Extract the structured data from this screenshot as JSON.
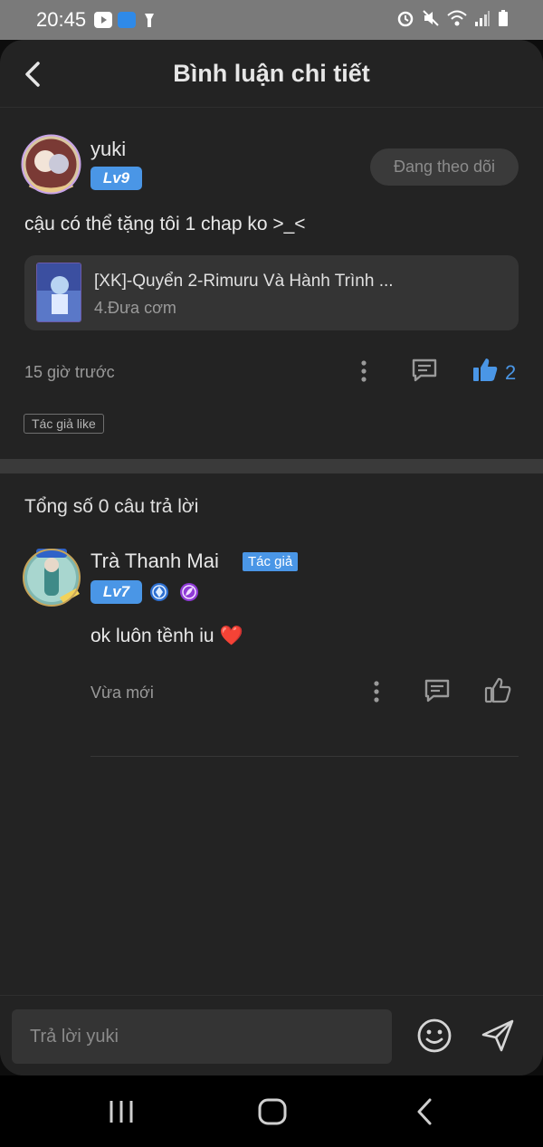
{
  "status_bar": {
    "time": "20:45",
    "icons": [
      "youtube-icon",
      "novel-app-icon",
      "flashlight-icon",
      "alarm-icon",
      "mute-icon",
      "wifi-icon",
      "signal-icon",
      "battery-icon"
    ]
  },
  "header": {
    "title": "Bình luận chi tiết",
    "back_icon": "back-arrow-icon"
  },
  "comment": {
    "username": "yuki",
    "level": "Lv9",
    "follow_label": "Đang theo dõi",
    "text": "cậu có thể tặng tôi 1 chap ko >_<",
    "book": {
      "title": "[XK]-Quyển 2-Rimuru Và Hành Trình ...",
      "chapter": "4.Đưa cơm"
    },
    "time": "15 giờ trước",
    "like_count": "2",
    "author_like_tag": "Tác giả like"
  },
  "replies": {
    "title": "Tổng số 0 câu trả lời",
    "items": [
      {
        "username": "Trà Thanh Mai",
        "author_tag": "Tác giả",
        "level": "Lv7",
        "text": "ok luôn tềnh iu",
        "emoji": "❤️",
        "time": "Vừa mới"
      }
    ]
  },
  "reply_bar": {
    "placeholder": "Trả lời yuki"
  },
  "colors": {
    "accent": "#4a96e6",
    "panel": "#232323",
    "card": "#343434"
  }
}
